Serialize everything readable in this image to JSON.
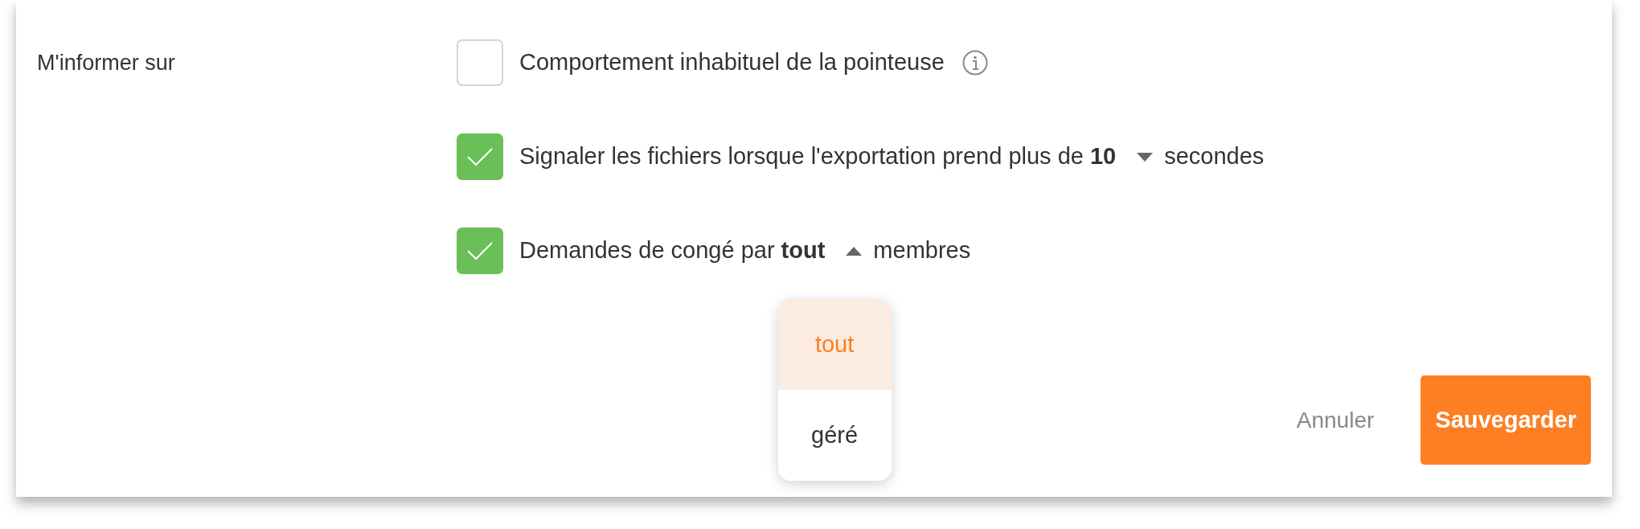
{
  "label": "M'informer sur",
  "options": [
    {
      "kind": "plain",
      "checked": false,
      "text": "Comportement inhabituel de la pointeuse",
      "info": true
    },
    {
      "kind": "select",
      "checked": true,
      "before": "Signaler les fichiers lorsque l'exportation prend plus de",
      "value": "10",
      "open": false,
      "after": "secondes"
    },
    {
      "kind": "select",
      "checked": true,
      "before": "Demandes de congé par",
      "value": "tout",
      "open": true,
      "after": "membres",
      "menu": [
        {
          "label": "tout",
          "selected": true
        },
        {
          "label": "géré",
          "selected": false
        }
      ]
    }
  ],
  "buttons": {
    "cancel": "Annuler",
    "save": "Sauvegarder"
  }
}
